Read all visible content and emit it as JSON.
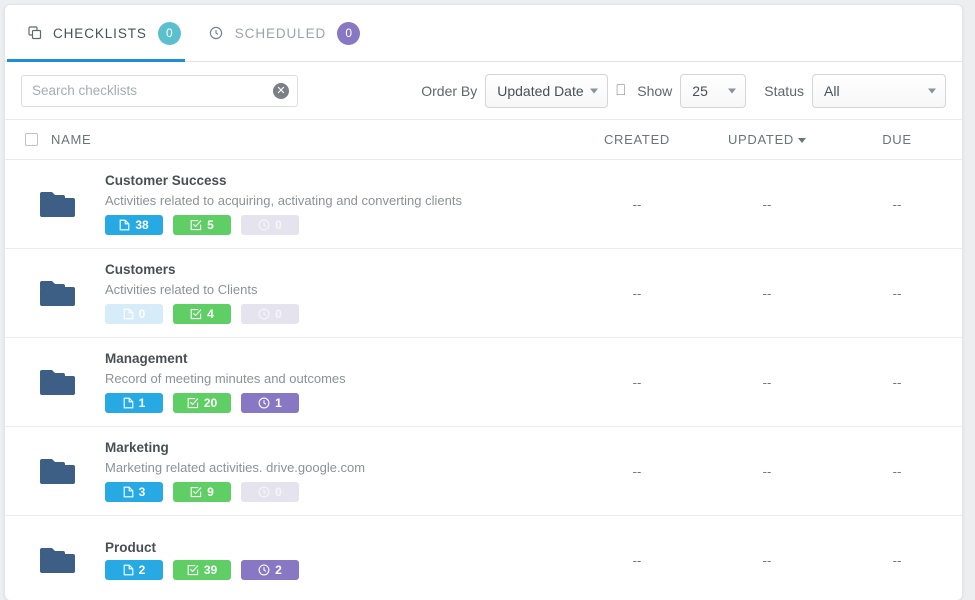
{
  "tabs": [
    {
      "label": "CHECKLISTS",
      "count": "0",
      "icon": "copy-icon",
      "active": true,
      "badge_color": "#5bc0cd"
    },
    {
      "label": "SCHEDULED",
      "count": "0",
      "icon": "clock-icon",
      "active": false,
      "badge_color": "#8878c3"
    }
  ],
  "accent_color": "#1f8dd6",
  "search": {
    "placeholder": "Search checklists",
    "value": "",
    "clear_label": "✕"
  },
  "filters": {
    "order_by_label": "Order By",
    "order_by_value": "Updated Date",
    "divider_glyph": "⎕",
    "show_label": "Show",
    "show_value": "25",
    "status_label": "Status",
    "status_value": "All"
  },
  "table": {
    "headers": {
      "name": "NAME",
      "created": "CREATED",
      "updated": "UPDATED",
      "due": "DUE"
    },
    "sorted_column": "UPDATED",
    "sort_direction": "desc",
    "empty_value": "--",
    "rows": [
      {
        "name": "Customer Success",
        "description": "Activities related to acquiring, activating and converting clients",
        "docs": "38",
        "tasks": "5",
        "scheduled": "0",
        "created": "--",
        "updated": "--",
        "due": "--"
      },
      {
        "name": "Customers",
        "description": "Activities related to Clients",
        "docs": "0",
        "tasks": "4",
        "scheduled": "0",
        "created": "--",
        "updated": "--",
        "due": "--"
      },
      {
        "name": "Management",
        "description": "Record of meeting minutes and outcomes",
        "docs": "1",
        "tasks": "20",
        "scheduled": "1",
        "created": "--",
        "updated": "--",
        "due": "--"
      },
      {
        "name": "Marketing",
        "description": "Marketing related activities. drive.google.com",
        "docs": "3",
        "tasks": "9",
        "scheduled": "0",
        "created": "--",
        "updated": "--",
        "due": "--"
      },
      {
        "name": "Product",
        "description": "",
        "docs": "2",
        "tasks": "39",
        "scheduled": "2",
        "created": "--",
        "updated": "--",
        "due": "--"
      }
    ]
  }
}
